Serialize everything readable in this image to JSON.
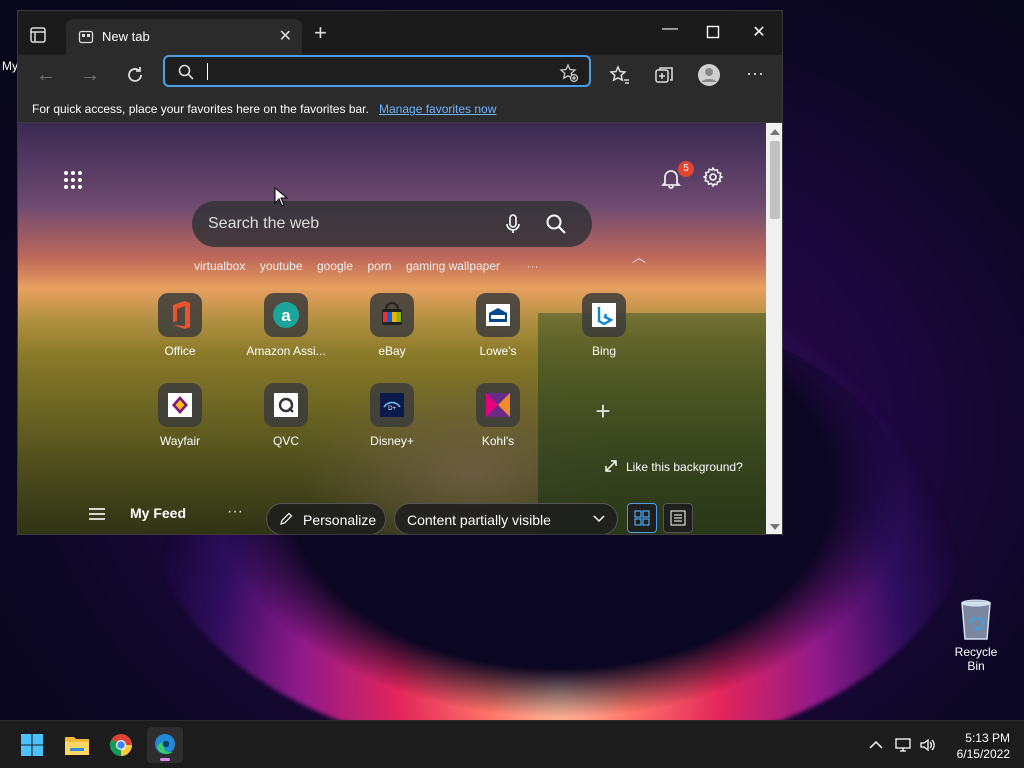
{
  "desktop": {
    "label_partial": "My",
    "recycle_bin": "Recycle Bin"
  },
  "browser": {
    "tab_title": "New tab",
    "address_value": "",
    "favorites_bar": {
      "message": "For quick access, place your favorites here on the favorites bar.",
      "link": "Manage favorites now"
    },
    "newtab": {
      "notifications_count": "5",
      "search_placeholder": "Search the web",
      "trending": [
        "virtualbox",
        "youtube",
        "google",
        "porn",
        "gaming wallpaper"
      ],
      "tiles": [
        {
          "label": "Office"
        },
        {
          "label": "Amazon Assi..."
        },
        {
          "label": "eBay"
        },
        {
          "label": "Lowe's"
        },
        {
          "label": "Bing"
        },
        {
          "label": "Wayfair"
        },
        {
          "label": "QVC"
        },
        {
          "label": "Disney+"
        },
        {
          "label": "Kohl's"
        }
      ],
      "like_background": "Like this background?",
      "feed": {
        "title": "My Feed",
        "personalize": "Personalize",
        "content_visibility": "Content partially visible"
      }
    }
  },
  "taskbar": {
    "time": "5:13 PM",
    "date": "6/15/2022"
  },
  "colors": {
    "accent": "#4a9fe8",
    "badge": "#e5452f"
  }
}
